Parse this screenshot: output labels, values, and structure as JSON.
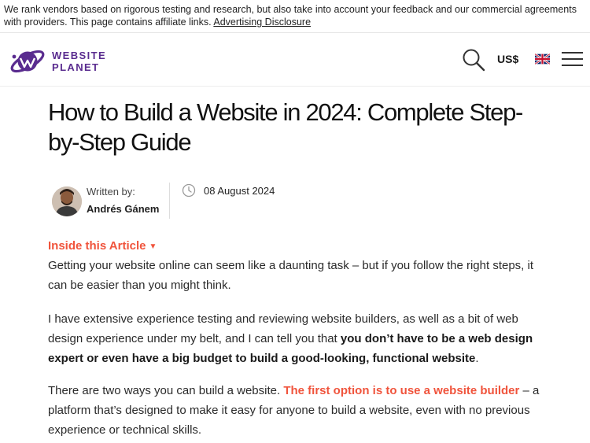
{
  "disclosure": {
    "text": "We rank vendors based on rigorous testing and research, but also take into account your feedback and our commercial agreements with providers. This page contains affiliate links.",
    "link": "Advertising Disclosure"
  },
  "header": {
    "logo_line1": "WEBSITE",
    "logo_line2": "PLANET",
    "currency": "US$",
    "search_icon": "search-icon",
    "flag_icon": "uk-flag-icon",
    "menu_icon": "hamburger-menu-icon",
    "brand_color": "#5a2c8f"
  },
  "article": {
    "title": "How to Build a Website in 2024: Complete Step-by-Step Guide",
    "written_by": "Written by:",
    "author": "Andrés Gánem",
    "date": "08 August 2024",
    "toc_label": "Inside this Article",
    "accent_color": "#f0543c",
    "p1": "Getting your website online can seem like a daunting task – but if you follow the right steps, it can be easier than you might think.",
    "p2_start": "I have extensive experience testing and reviewing website builders, as well as a bit of web design experience under my belt, and I can tell you that ",
    "p2_bold": "you don’t have to be a web design expert or even have a big budget to build a good-looking, functional website",
    "p2_end": ".",
    "p3_start": "There are two ways you can build a website. ",
    "p3_link": "The first option is to use a website builder",
    "p3_end": " – a platform that’s designed to make it easy for anyone to build a website, even with no previous experience or technical skills."
  }
}
